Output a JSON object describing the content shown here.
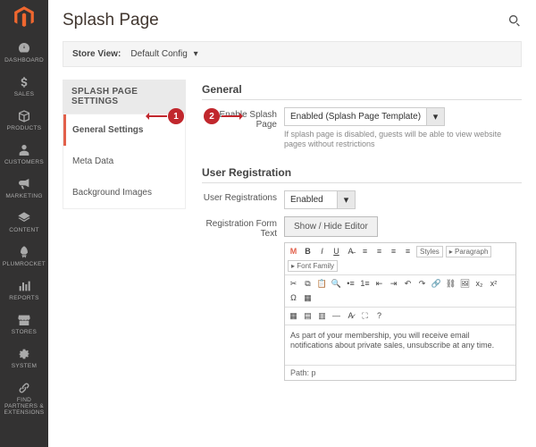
{
  "sidenav": {
    "items": [
      {
        "label": "DASHBOARD"
      },
      {
        "label": "SALES"
      },
      {
        "label": "PRODUCTS"
      },
      {
        "label": "CUSTOMERS"
      },
      {
        "label": "MARKETING"
      },
      {
        "label": "CONTENT"
      },
      {
        "label": "PLUMROCKET"
      },
      {
        "label": "REPORTS"
      },
      {
        "label": "STORES"
      },
      {
        "label": "SYSTEM"
      },
      {
        "label": "FIND PARTNERS & EXTENSIONS"
      }
    ]
  },
  "page": {
    "title": "Splash Page"
  },
  "scope": {
    "label": "Store View:",
    "value": "Default Config"
  },
  "settings_nav": {
    "heading": "SPLASH PAGE SETTINGS",
    "items": [
      {
        "label": "General Settings",
        "active": true
      },
      {
        "label": "Meta Data",
        "active": false
      },
      {
        "label": "Background Images",
        "active": false
      }
    ]
  },
  "sections": {
    "general": {
      "heading": "General",
      "enable": {
        "label": "Enable Splash Page",
        "value": "Enabled (Splash Page Template)",
        "hint": "If splash page is disabled, guests will be able to view website pages without restrictions"
      }
    },
    "user_reg": {
      "heading": "User Registration",
      "registrations": {
        "label": "User Registrations",
        "value": "Enabled"
      },
      "form_text": {
        "label": "Registration Form Text",
        "toggle": "Show / Hide Editor",
        "toolbar": {
          "styles": "Styles",
          "paragraph": "Paragraph",
          "font_family": "Font Family"
        },
        "body": "As part of your membership, you will receive email notifications about private sales, unsubscribe at any time.",
        "path": "Path: p"
      }
    }
  },
  "callouts": {
    "one": "1",
    "two": "2"
  }
}
